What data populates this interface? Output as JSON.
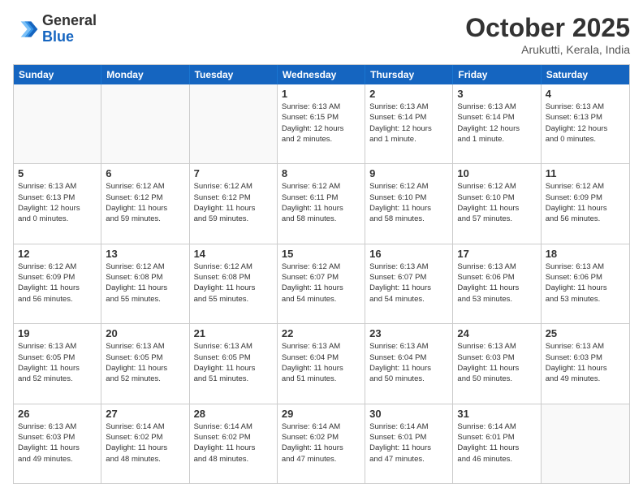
{
  "logo": {
    "general": "General",
    "blue": "Blue"
  },
  "title": "October 2025",
  "location": "Arukutti, Kerala, India",
  "headers": [
    "Sunday",
    "Monday",
    "Tuesday",
    "Wednesday",
    "Thursday",
    "Friday",
    "Saturday"
  ],
  "rows": [
    [
      {
        "day": "",
        "lines": []
      },
      {
        "day": "",
        "lines": []
      },
      {
        "day": "",
        "lines": []
      },
      {
        "day": "1",
        "lines": [
          "Sunrise: 6:13 AM",
          "Sunset: 6:15 PM",
          "Daylight: 12 hours",
          "and 2 minutes."
        ]
      },
      {
        "day": "2",
        "lines": [
          "Sunrise: 6:13 AM",
          "Sunset: 6:14 PM",
          "Daylight: 12 hours",
          "and 1 minute."
        ]
      },
      {
        "day": "3",
        "lines": [
          "Sunrise: 6:13 AM",
          "Sunset: 6:14 PM",
          "Daylight: 12 hours",
          "and 1 minute."
        ]
      },
      {
        "day": "4",
        "lines": [
          "Sunrise: 6:13 AM",
          "Sunset: 6:13 PM",
          "Daylight: 12 hours",
          "and 0 minutes."
        ]
      }
    ],
    [
      {
        "day": "5",
        "lines": [
          "Sunrise: 6:13 AM",
          "Sunset: 6:13 PM",
          "Daylight: 12 hours",
          "and 0 minutes."
        ]
      },
      {
        "day": "6",
        "lines": [
          "Sunrise: 6:12 AM",
          "Sunset: 6:12 PM",
          "Daylight: 11 hours",
          "and 59 minutes."
        ]
      },
      {
        "day": "7",
        "lines": [
          "Sunrise: 6:12 AM",
          "Sunset: 6:12 PM",
          "Daylight: 11 hours",
          "and 59 minutes."
        ]
      },
      {
        "day": "8",
        "lines": [
          "Sunrise: 6:12 AM",
          "Sunset: 6:11 PM",
          "Daylight: 11 hours",
          "and 58 minutes."
        ]
      },
      {
        "day": "9",
        "lines": [
          "Sunrise: 6:12 AM",
          "Sunset: 6:10 PM",
          "Daylight: 11 hours",
          "and 58 minutes."
        ]
      },
      {
        "day": "10",
        "lines": [
          "Sunrise: 6:12 AM",
          "Sunset: 6:10 PM",
          "Daylight: 11 hours",
          "and 57 minutes."
        ]
      },
      {
        "day": "11",
        "lines": [
          "Sunrise: 6:12 AM",
          "Sunset: 6:09 PM",
          "Daylight: 11 hours",
          "and 56 minutes."
        ]
      }
    ],
    [
      {
        "day": "12",
        "lines": [
          "Sunrise: 6:12 AM",
          "Sunset: 6:09 PM",
          "Daylight: 11 hours",
          "and 56 minutes."
        ]
      },
      {
        "day": "13",
        "lines": [
          "Sunrise: 6:12 AM",
          "Sunset: 6:08 PM",
          "Daylight: 11 hours",
          "and 55 minutes."
        ]
      },
      {
        "day": "14",
        "lines": [
          "Sunrise: 6:12 AM",
          "Sunset: 6:08 PM",
          "Daylight: 11 hours",
          "and 55 minutes."
        ]
      },
      {
        "day": "15",
        "lines": [
          "Sunrise: 6:12 AM",
          "Sunset: 6:07 PM",
          "Daylight: 11 hours",
          "and 54 minutes."
        ]
      },
      {
        "day": "16",
        "lines": [
          "Sunrise: 6:13 AM",
          "Sunset: 6:07 PM",
          "Daylight: 11 hours",
          "and 54 minutes."
        ]
      },
      {
        "day": "17",
        "lines": [
          "Sunrise: 6:13 AM",
          "Sunset: 6:06 PM",
          "Daylight: 11 hours",
          "and 53 minutes."
        ]
      },
      {
        "day": "18",
        "lines": [
          "Sunrise: 6:13 AM",
          "Sunset: 6:06 PM",
          "Daylight: 11 hours",
          "and 53 minutes."
        ]
      }
    ],
    [
      {
        "day": "19",
        "lines": [
          "Sunrise: 6:13 AM",
          "Sunset: 6:05 PM",
          "Daylight: 11 hours",
          "and 52 minutes."
        ]
      },
      {
        "day": "20",
        "lines": [
          "Sunrise: 6:13 AM",
          "Sunset: 6:05 PM",
          "Daylight: 11 hours",
          "and 52 minutes."
        ]
      },
      {
        "day": "21",
        "lines": [
          "Sunrise: 6:13 AM",
          "Sunset: 6:05 PM",
          "Daylight: 11 hours",
          "and 51 minutes."
        ]
      },
      {
        "day": "22",
        "lines": [
          "Sunrise: 6:13 AM",
          "Sunset: 6:04 PM",
          "Daylight: 11 hours",
          "and 51 minutes."
        ]
      },
      {
        "day": "23",
        "lines": [
          "Sunrise: 6:13 AM",
          "Sunset: 6:04 PM",
          "Daylight: 11 hours",
          "and 50 minutes."
        ]
      },
      {
        "day": "24",
        "lines": [
          "Sunrise: 6:13 AM",
          "Sunset: 6:03 PM",
          "Daylight: 11 hours",
          "and 50 minutes."
        ]
      },
      {
        "day": "25",
        "lines": [
          "Sunrise: 6:13 AM",
          "Sunset: 6:03 PM",
          "Daylight: 11 hours",
          "and 49 minutes."
        ]
      }
    ],
    [
      {
        "day": "26",
        "lines": [
          "Sunrise: 6:13 AM",
          "Sunset: 6:03 PM",
          "Daylight: 11 hours",
          "and 49 minutes."
        ]
      },
      {
        "day": "27",
        "lines": [
          "Sunrise: 6:14 AM",
          "Sunset: 6:02 PM",
          "Daylight: 11 hours",
          "and 48 minutes."
        ]
      },
      {
        "day": "28",
        "lines": [
          "Sunrise: 6:14 AM",
          "Sunset: 6:02 PM",
          "Daylight: 11 hours",
          "and 48 minutes."
        ]
      },
      {
        "day": "29",
        "lines": [
          "Sunrise: 6:14 AM",
          "Sunset: 6:02 PM",
          "Daylight: 11 hours",
          "and 47 minutes."
        ]
      },
      {
        "day": "30",
        "lines": [
          "Sunrise: 6:14 AM",
          "Sunset: 6:01 PM",
          "Daylight: 11 hours",
          "and 47 minutes."
        ]
      },
      {
        "day": "31",
        "lines": [
          "Sunrise: 6:14 AM",
          "Sunset: 6:01 PM",
          "Daylight: 11 hours",
          "and 46 minutes."
        ]
      },
      {
        "day": "",
        "lines": []
      }
    ]
  ]
}
